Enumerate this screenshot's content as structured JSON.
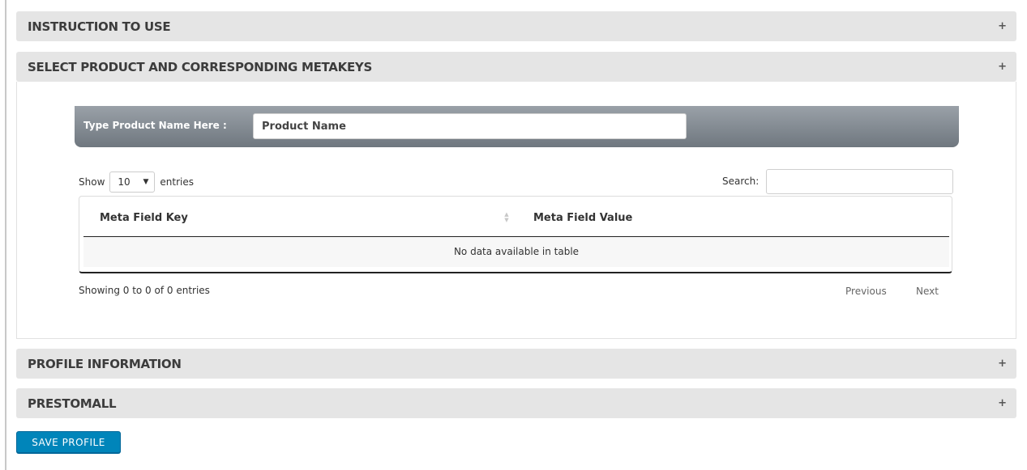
{
  "panels": {
    "instruction": {
      "title": "INSTRUCTION TO USE",
      "toggle": "+"
    },
    "select_product": {
      "title": "SELECT PRODUCT AND CORRESPONDING METAKEYS",
      "toggle": "+"
    },
    "profile_info": {
      "title": "PROFILE INFORMATION",
      "toggle": "+"
    },
    "prestomall": {
      "title": "PRESTOMALL",
      "toggle": "+"
    }
  },
  "product_search": {
    "label": "Type Product Name Here :",
    "placeholder": "Product Name"
  },
  "table_controls": {
    "show_label": "Show",
    "entries_label": "entries",
    "page_length": "10",
    "search_label": "Search:"
  },
  "table": {
    "columns": [
      "Meta Field Key",
      "Meta Field Value"
    ],
    "empty_message": "No data available in table"
  },
  "pagination": {
    "info": "Showing 0 to 0 of 0 entries",
    "previous": "Previous",
    "next": "Next"
  },
  "actions": {
    "save_profile": "SAVE PROFILE"
  }
}
